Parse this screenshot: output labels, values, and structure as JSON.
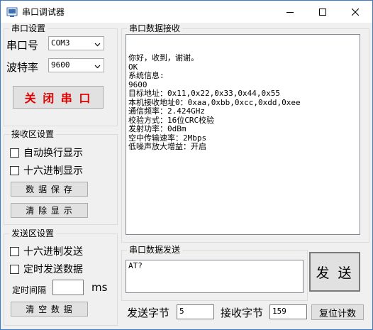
{
  "window": {
    "title": "串口调试器",
    "icon": "serial-app-icon"
  },
  "serial_settings": {
    "group_label": "串口设置",
    "port_label": "串口号",
    "port_value": "COM3",
    "baud_label": "波特率",
    "baud_value": "9600",
    "toggle_button": "关 闭 串 口"
  },
  "receive_settings": {
    "group_label": "接收区设置",
    "auto_wrap": "自动换行显示",
    "hex_display": "十六进制显示",
    "save_button": "数 据 保 存",
    "clear_button": "清 除 显 示"
  },
  "send_settings": {
    "group_label": "发送区设置",
    "hex_send": "十六进制发送",
    "timed_send": "定时发送数据",
    "interval_label": "定时间隔",
    "interval_value": "",
    "interval_unit": "ms",
    "clear_button": "清 空 数 据"
  },
  "receive_area": {
    "group_label": "串口数据接收",
    "lines": [
      "你好，收到，谢谢。",
      "OK",
      "系统信息:",
      "9600",
      "目标地址：0x11,0x22,0x33,0x44,0x55",
      "本机接收地址0：0xaa,0xbb,0xcc,0xdd,0xee",
      "通信频率：2.424GHz",
      "校验方式：16位CRC校验",
      "发射功率：0dBm",
      "空中传输速率：2Mbps",
      "低噪声放大增益：开启"
    ]
  },
  "send_area": {
    "group_label": "串口数据发送",
    "text": "AT?",
    "send_button": "发 送"
  },
  "status": {
    "sent_label": "发送字节",
    "sent_value": "5",
    "recv_label": "接收字节",
    "recv_value": "159",
    "reset_button": "复位计数"
  }
}
